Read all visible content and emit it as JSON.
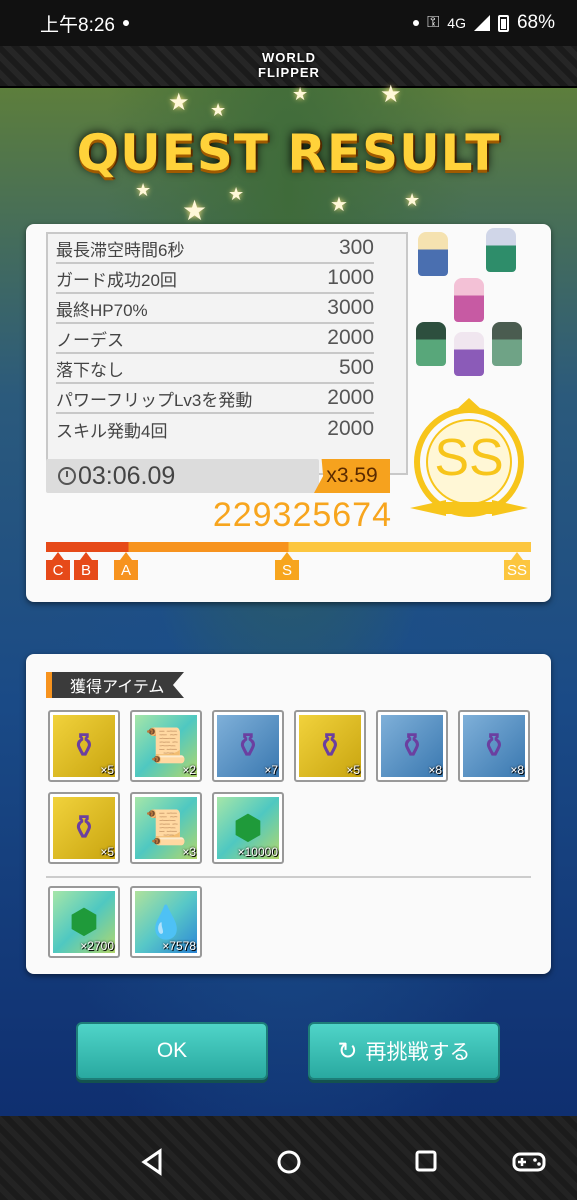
{
  "status_bar": {
    "time": "上午8:26",
    "network": "4G",
    "battery": "68%"
  },
  "logo": {
    "line1": "WORLD",
    "line2": "FLIPPER"
  },
  "title": "QUEST RESULT",
  "bonuses": [
    {
      "label": "最長滞空時間6秒",
      "value": "300"
    },
    {
      "label": "ガード成功20回",
      "value": "1000"
    },
    {
      "label": "最終HP70%",
      "value": "3000"
    },
    {
      "label": "ノーデス",
      "value": "2000"
    },
    {
      "label": "落下なし",
      "value": "500"
    },
    {
      "label": "パワーフリップLv3を発動",
      "value": "2000"
    },
    {
      "label": "スキル発動4回",
      "value": "2000"
    }
  ],
  "time": "03:06.09",
  "multiplier": "x3.59",
  "score": "229325674",
  "rank": "SS",
  "rank_marks": [
    "C",
    "B",
    "A",
    "S",
    "SS"
  ],
  "items_label": "獲得アイテム",
  "items": [
    {
      "icon": "purple-potion-icon",
      "bg": "gold",
      "count": "×5"
    },
    {
      "icon": "purple-scroll-icon",
      "bg": "rainbow",
      "count": "×2"
    },
    {
      "icon": "purple-potion-icon",
      "bg": "blue",
      "count": "×7"
    },
    {
      "icon": "purple-potion-icon",
      "bg": "gold",
      "count": "×5"
    },
    {
      "icon": "purple-potion-icon",
      "bg": "blue",
      "count": "×8"
    },
    {
      "icon": "purple-potion-icon",
      "bg": "blue",
      "count": "×8"
    },
    {
      "icon": "purple-potion-icon",
      "bg": "gold",
      "count": "×5"
    },
    {
      "icon": "purple-scroll-icon",
      "bg": "rainbow",
      "count": "×3"
    },
    {
      "icon": "green-gem-icon",
      "bg": "rainbow",
      "count": "×10000"
    }
  ],
  "extra_items": [
    {
      "icon": "green-gem-icon",
      "bg": "rainbow",
      "count": "×2700"
    },
    {
      "icon": "blue-flame-icon",
      "bg": "rainbow2",
      "count": "×7578"
    }
  ],
  "buttons": {
    "ok": "OK",
    "retry": "再挑戦する"
  },
  "colors": {
    "accent": "#f7931e",
    "score": "#f7a51e",
    "button": "#2fb5ab",
    "rank": "#f7c51b"
  }
}
